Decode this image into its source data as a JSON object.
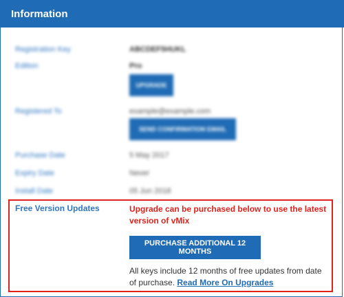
{
  "header": {
    "title": "Information"
  },
  "blurred_rows": [
    {
      "label": "Registration Key",
      "value": "ABCDEF5HUKL"
    },
    {
      "label": "Edition",
      "value": "Pro"
    },
    {
      "label": "Registered To",
      "value": "example@example.com"
    },
    {
      "label": "Purchase Date",
      "value": "5 May 2017"
    },
    {
      "label": "Expiry Date",
      "value": "Never"
    },
    {
      "label": "Install Date",
      "value": "05 Jun 2018"
    }
  ],
  "blurred_buttons": {
    "upgrade": "UPGRADE",
    "send_confirmation": "SEND CONFIRMATION EMAIL"
  },
  "free_updates": {
    "label": "Free Version Updates",
    "message": "Upgrade can be purchased below to use the latest version of vMix",
    "purchase_button": "PURCHASE ADDITIONAL 12 MONTHS",
    "note": "All keys include 12 months of free updates from date of purchase.",
    "link": "Read More On Upgrades"
  },
  "colors": {
    "brand_blue": "#1f6bb5",
    "highlight_red": "#e0211b"
  }
}
